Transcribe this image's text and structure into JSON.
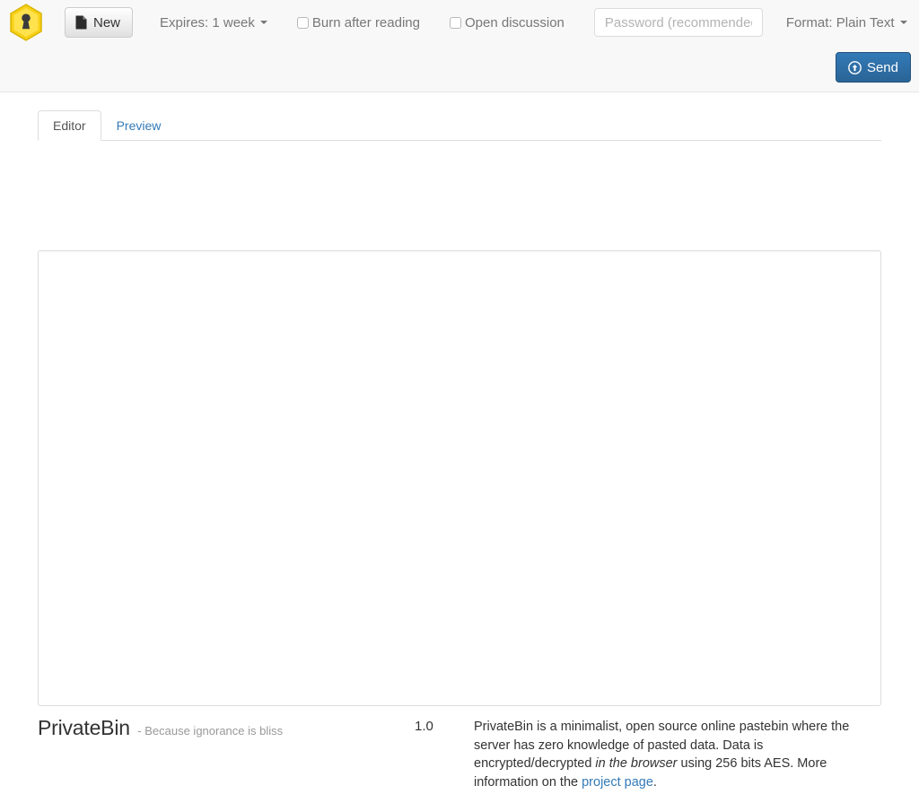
{
  "app": {
    "name": "PrivateBin",
    "logo_icon": "hexagon-keyhole-logo",
    "logo_color": "#f7d117"
  },
  "toolbar": {
    "new_button": {
      "label": "New",
      "icon": "file-icon"
    },
    "expires": {
      "label": "Expires: 1 week",
      "caret_icon": "caret-down-icon"
    },
    "burn_after_reading": {
      "label": "Burn after reading",
      "checked": false
    },
    "open_discussion": {
      "label": "Open discussion",
      "checked": false
    },
    "password": {
      "value": "",
      "placeholder": "Password (recommended)"
    },
    "format": {
      "label": "Format: Plain Text",
      "caret_icon": "caret-down-icon"
    },
    "send_button": {
      "label": "Send",
      "icon": "upload-icon",
      "color": "#337ab7"
    }
  },
  "tabs": [
    {
      "label": "Editor",
      "active": true
    },
    {
      "label": "Preview",
      "active": false
    }
  ],
  "editor": {
    "value": "",
    "placeholder": ""
  },
  "footer": {
    "brand_name": "PrivateBin",
    "slogan": "- Because ignorance is bliss",
    "version": "1.0",
    "description_part1": "PrivateBin is a minimalist, open source online pastebin where the server has zero knowledge of pasted data. Data is encrypted/decrypted ",
    "description_italic": "in the browser",
    "description_part2": " using 256 bits AES. More information on the ",
    "description_link": "project page",
    "description_end": "."
  }
}
